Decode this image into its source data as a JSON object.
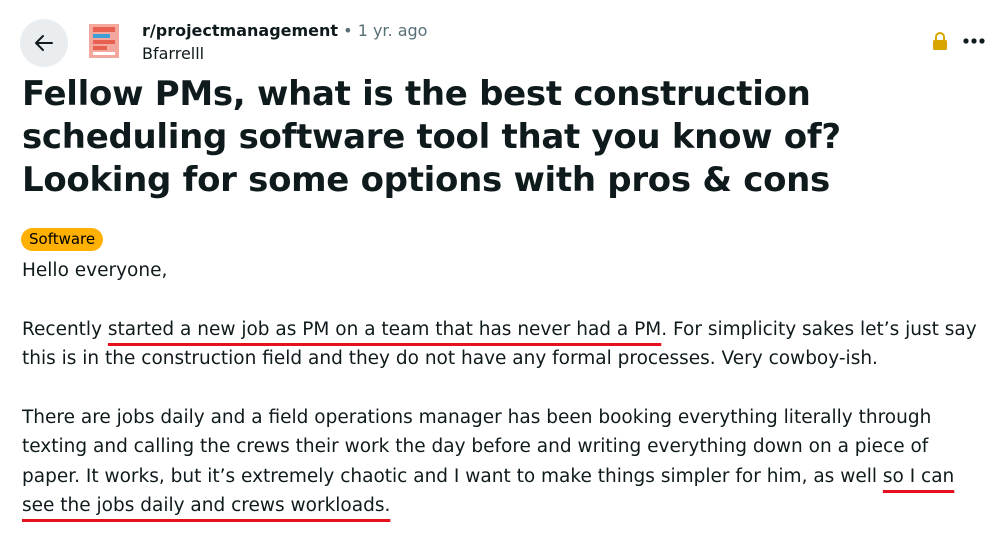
{
  "post": {
    "subreddit": "r/projectmanagement",
    "separator": "•",
    "age": "1 yr. ago",
    "author": "Bfarrelll",
    "title": "Fellow PMs, what is the best construction scheduling software tool that you know of? Looking for some options with pros & cons",
    "flair": "Software",
    "body": {
      "greeting": "Hello everyone,",
      "p2_a": "Recently ",
      "p2_underlined": "started a new job as PM on a team that has never had a PM",
      "p2_b": ". For simplicity sakes let’s just say this is in the construction field and they do not have any formal processes. Very cowboy-ish.",
      "p3_a": "There are jobs daily and a field operations manager has been booking everything literally through texting and calling the crews their work the day before and writing everything down on a piece of paper. It works, but it’s extremely chaotic and I want to make things simpler for him, as well ",
      "p3_underlined": "so I can see the jobs daily and crews workloads."
    }
  },
  "colors": {
    "flair_bg": "#ffb000",
    "underline": "#e8101d",
    "lock": "#d9a500",
    "back_bg": "#eaedef"
  },
  "icons": {
    "back": "back-arrow-icon",
    "subreddit": "subreddit-icon",
    "lock": "lock-icon",
    "more": "more-options-icon"
  }
}
